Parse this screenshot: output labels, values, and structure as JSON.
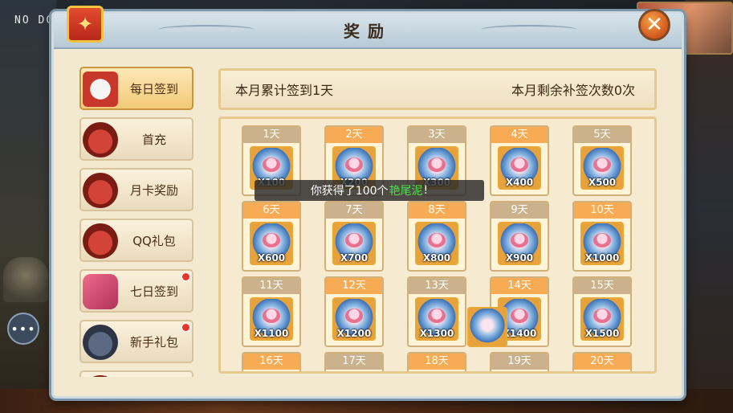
{
  "hud": {
    "top_left_text": "NO DC"
  },
  "window": {
    "title": "奖励",
    "close_symbol": "✕"
  },
  "sidebar": {
    "items": [
      {
        "label": "每日签到",
        "icon": "sign-in-card-icon",
        "active": true,
        "badge": false
      },
      {
        "label": "首充",
        "icon": "red-basket-icon",
        "active": false,
        "badge": false
      },
      {
        "label": "月卡奖励",
        "icon": "red-basket-icon",
        "active": false,
        "badge": false
      },
      {
        "label": "QQ礼包",
        "icon": "red-basket-icon",
        "active": false,
        "badge": false
      },
      {
        "label": "七日签到",
        "icon": "scroll-icon",
        "active": false,
        "badge": true
      },
      {
        "label": "新手礼包",
        "icon": "gift-bag-icon",
        "active": false,
        "badge": true
      },
      {
        "label": "",
        "icon": "red-basket-icon",
        "active": false,
        "badge": false
      }
    ]
  },
  "summary": {
    "signed_text": "本月累计签到1天",
    "remaining_text": "本月剩余补签次数0次"
  },
  "rewards": [
    {
      "day": "1天",
      "qty": "X100"
    },
    {
      "day": "2天",
      "qty": "X200"
    },
    {
      "day": "3天",
      "qty": "X300"
    },
    {
      "day": "4天",
      "qty": "X400"
    },
    {
      "day": "5天",
      "qty": "X500"
    },
    {
      "day": "6天",
      "qty": "X600"
    },
    {
      "day": "7天",
      "qty": "X700"
    },
    {
      "day": "8天",
      "qty": "X800"
    },
    {
      "day": "9天",
      "qty": "X900"
    },
    {
      "day": "10天",
      "qty": "X1000"
    },
    {
      "day": "11天",
      "qty": "X1100"
    },
    {
      "day": "12天",
      "qty": "X1200"
    },
    {
      "day": "13天",
      "qty": "X1300"
    },
    {
      "day": "14天",
      "qty": "X1400"
    },
    {
      "day": "15天",
      "qty": "X1500"
    },
    {
      "day": "16天",
      "qty": ""
    },
    {
      "day": "17天",
      "qty": ""
    },
    {
      "day": "18天",
      "qty": ""
    },
    {
      "day": "19天",
      "qty": ""
    },
    {
      "day": "20天",
      "qty": ""
    }
  ],
  "toast": {
    "prefix": "你获得了100个",
    "item_name": "艳尾泥",
    "suffix": "!"
  },
  "chat_button": "•••",
  "colors": {
    "odd_day_header": "#cbb28c",
    "even_day_header": "#f7ab54",
    "toast_item_name": "#4de04d",
    "badge_red": "#e8322a"
  }
}
